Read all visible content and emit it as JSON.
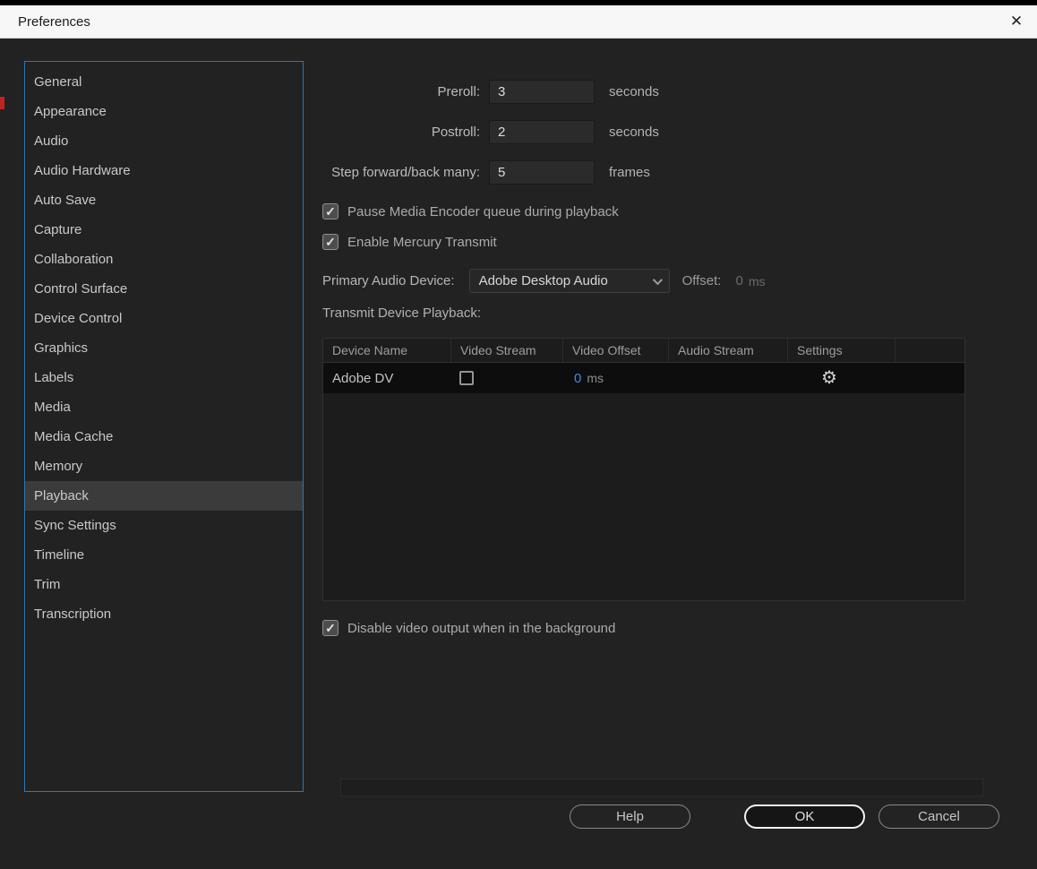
{
  "icons": {
    "close": "✕",
    "check": "✓",
    "gear": "⚙"
  },
  "colors": {
    "accent_blue": "#2d76b5",
    "value_blue": "#3f8ce0"
  },
  "titlebar": {
    "title": "Preferences"
  },
  "sidebar": {
    "items": [
      {
        "label": "General"
      },
      {
        "label": "Appearance"
      },
      {
        "label": "Audio"
      },
      {
        "label": "Audio Hardware"
      },
      {
        "label": "Auto Save"
      },
      {
        "label": "Capture"
      },
      {
        "label": "Collaboration"
      },
      {
        "label": "Control Surface"
      },
      {
        "label": "Device Control"
      },
      {
        "label": "Graphics"
      },
      {
        "label": "Labels"
      },
      {
        "label": "Media"
      },
      {
        "label": "Media Cache"
      },
      {
        "label": "Memory"
      },
      {
        "label": "Playback",
        "selected": true
      },
      {
        "label": "Sync Settings"
      },
      {
        "label": "Timeline"
      },
      {
        "label": "Trim"
      },
      {
        "label": "Transcription"
      }
    ]
  },
  "fields": [
    {
      "label": "Preroll:",
      "value": "3",
      "unit": "seconds"
    },
    {
      "label": "Postroll:",
      "value": "2",
      "unit": "seconds"
    },
    {
      "label": "Step forward/back many:",
      "value": "5",
      "unit": "frames"
    }
  ],
  "checkboxes": {
    "pause_encoder": {
      "label": "Pause Media Encoder queue during playback",
      "checked": true
    },
    "mercury": {
      "label": "Enable Mercury Transmit",
      "checked": true
    },
    "disable_background": {
      "label": "Disable video output when in the background",
      "checked": true
    }
  },
  "audio_device": {
    "label": "Primary Audio Device:",
    "value": "Adobe Desktop Audio",
    "offset_label": "Offset:",
    "offset_value": "0",
    "offset_unit": "ms"
  },
  "transmit": {
    "label": "Transmit Device Playback:",
    "table": {
      "headers": [
        "Device Name",
        "Video Stream",
        "Video Offset",
        "Audio Stream",
        "Settings"
      ],
      "rows": [
        {
          "device": "Adobe DV",
          "video_stream_checked": false,
          "video_offset_value": "0",
          "video_offset_unit": "ms"
        }
      ]
    }
  },
  "footer": {
    "help": "Help",
    "ok": "OK",
    "cancel": "Cancel"
  }
}
